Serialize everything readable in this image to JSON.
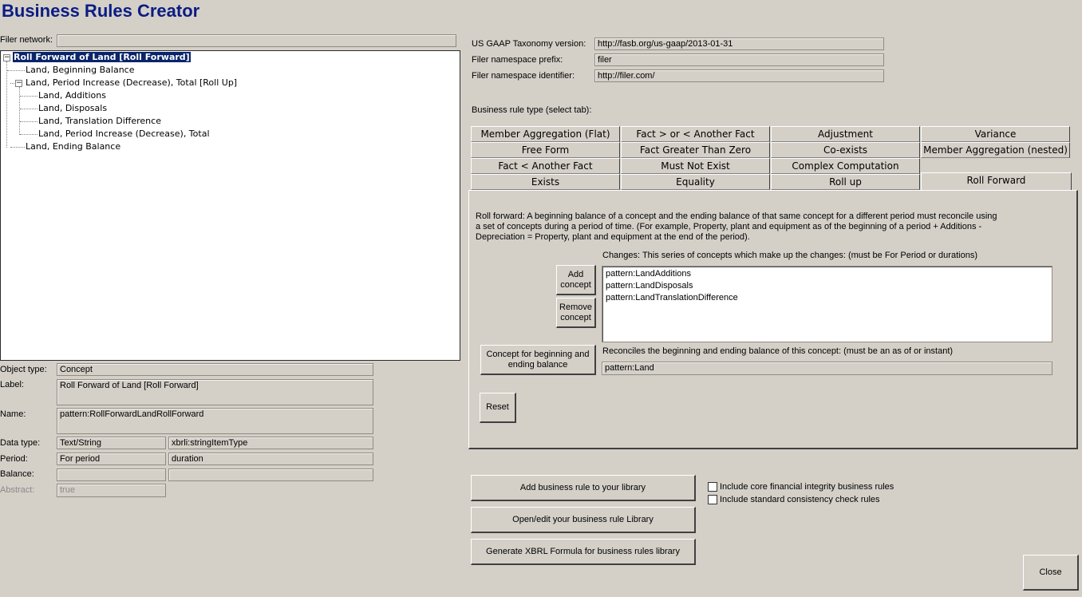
{
  "app": {
    "title": "Business Rules Creator"
  },
  "filer_network": {
    "label": "Filer network:",
    "value": ""
  },
  "tree": {
    "nodes": [
      {
        "label": "Roll Forward of Land [Roll Forward]",
        "selected": true
      },
      {
        "label": "Land, Beginning Balance"
      },
      {
        "label": "Land, Period Increase (Decrease), Total [Roll Up]"
      },
      {
        "label": "Land, Additions"
      },
      {
        "label": "Land, Disposals"
      },
      {
        "label": "Land, Translation Difference"
      },
      {
        "label": "Land, Period Increase (Decrease), Total"
      },
      {
        "label": "Land, Ending Balance"
      }
    ]
  },
  "properties": {
    "object_type": {
      "label": "Object type:",
      "value": "Concept"
    },
    "label": {
      "label": "Label:",
      "value": "Roll Forward of Land [Roll Forward]"
    },
    "name": {
      "label": "Name:",
      "value": "pattern:RollForwardLandRollForward"
    },
    "data_type": {
      "label": "Data type:",
      "value1": "Text/String",
      "value2": "xbrli:stringItemType"
    },
    "period": {
      "label": "Period:",
      "value1": "For period",
      "value2": "duration"
    },
    "balance": {
      "label": "Balance:",
      "value1": "",
      "value2": ""
    },
    "abstract": {
      "label": "Abstract:",
      "value": "true"
    }
  },
  "taxonomy": {
    "version_label": "US GAAP Taxonomy version:",
    "version_value": "http://fasb.org/us-gaap/2013-01-31",
    "prefix_label": "Filer namespace prefix:",
    "prefix_value": "filer",
    "identifier_label": "Filer namespace identifier:",
    "identifier_value": "http://filer.com/"
  },
  "rule_type": {
    "label": "Business rule type (select tab):",
    "tabs": {
      "member_aggregation_flat": "Member Aggregation (Flat)",
      "fact_gt_lt": "Fact > or < Another Fact",
      "adjustment": "Adjustment",
      "variance": "Variance",
      "free_form": "Free Form",
      "fact_gt_zero": "Fact Greater Than Zero",
      "co_exists": "Co-exists",
      "member_aggregation_nested": "Member Aggregation (nested)",
      "fact_lt": "Fact < Another Fact",
      "must_not_exist": "Must Not Exist",
      "complex_computation": "Complex Computation",
      "exists": "Exists",
      "equality": "Equality",
      "roll_up": "Roll up",
      "roll_forward": "Roll Forward"
    }
  },
  "roll_forward": {
    "description_line1": "Roll forward: A beginning balance of a concept and the ending balance of that same concept for a different period must reconcile using",
    "description_line2": "a set of concepts during a period of time.  (For example, Property, plant and equipment as of the beginning of a period + Additions -",
    "description_line3": "Depreciation = Property, plant and equipment at the end of the period).",
    "changes_label": "Changes: This series of concepts which make up the changes: (must be For Period or durations)",
    "changes": [
      "pattern:LandAdditions",
      "pattern:LandDisposals",
      "pattern:LandTranslationDifference"
    ],
    "add_line1": "Add",
    "add_line2": "concept",
    "remove_line1": "Remove",
    "remove_line2": "concept",
    "concept_btn_line1": "Concept for beginning and",
    "concept_btn_line2": "ending balance",
    "reconciles_label": "Reconciles the beginning and ending balance of this concept: (must be an as of or instant)",
    "reconciles_value": "pattern:Land",
    "reset": "Reset"
  },
  "actions": {
    "add_rule": "Add business rule to your library",
    "open_library": "Open/edit your business rule Library",
    "generate": "Generate XBRL Formula for business rules library",
    "core_checkbox": "Include core financial integrity business rules",
    "standard_checkbox": "Include standard consistency check rules",
    "close": "Close"
  }
}
